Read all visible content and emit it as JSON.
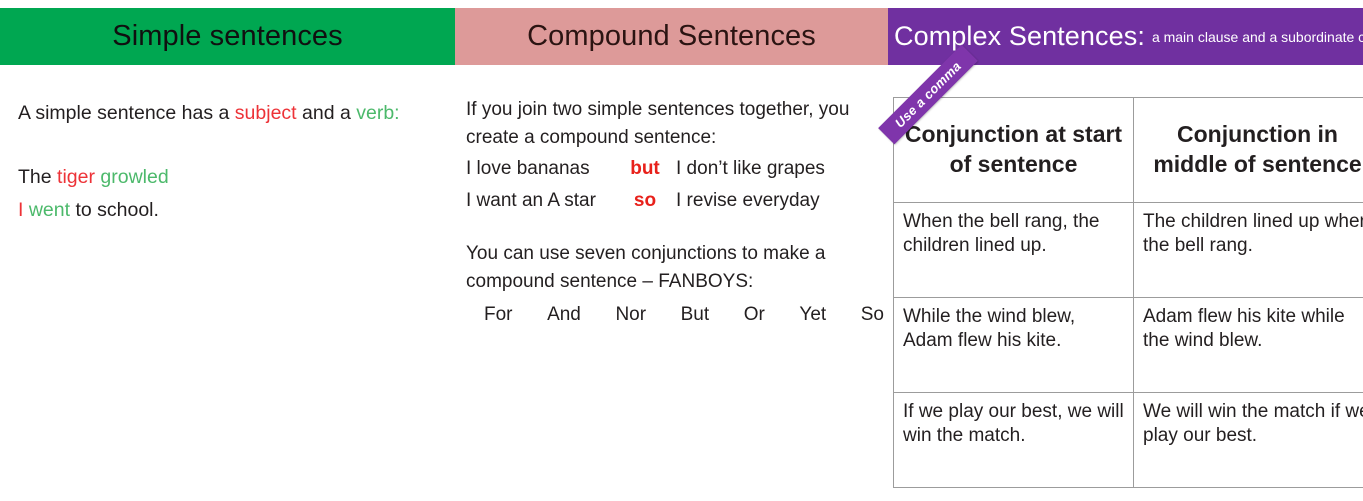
{
  "columns": {
    "simple": {
      "header": "Simple sentences",
      "header_bg": "#00a751",
      "definition": {
        "prefix": "A simple sentence has a ",
        "subject_word": "subject",
        "middle": " and a ",
        "verb_word": "verb",
        "suffix": ":"
      },
      "examples": [
        {
          "part1": "The ",
          "subject": "tiger",
          "space": " ",
          "verb": "growled",
          "part2": ""
        },
        {
          "part1": "",
          "subject": "I",
          "space": " ",
          "verb": "went",
          "part2": " to school."
        }
      ],
      "subject_color": "#ed3237",
      "verb_color": "#4cb96b"
    },
    "compound": {
      "header": "Compound Sentences",
      "header_bg": "#dd9a99",
      "intro": "If you join two simple sentences together, you create a compound sentence:",
      "examples": [
        {
          "left": "I love bananas",
          "conjunction": "but",
          "right": "I don’t like grapes"
        },
        {
          "left": "I want an A star",
          "conjunction": "so",
          "right": "I revise everyday"
        }
      ],
      "conjunction_color": "#e8211b",
      "fanboys_intro": "You can use seven conjunctions to make a compound sentence – FANBOYS:",
      "fanboys": [
        "For",
        "And",
        "Nor",
        "But",
        "Or",
        "Yet",
        "So"
      ]
    },
    "complex": {
      "header": "Complex Sentences:",
      "header_subtitle": "a main clause and a subordinate clause",
      "header_bg": "#7030a0",
      "ribbon_label": "Use a comma",
      "ribbon_bg": "#7f35ab",
      "table": {
        "headers": [
          "Conjunction at start of sentence",
          "Conjunction in middle of sentence"
        ],
        "rows": [
          [
            "When the bell rang, the children lined up.",
            "The children lined up when the bell rang."
          ],
          [
            "While the wind blew, Adam flew his kite.",
            "Adam flew his kite while the wind blew."
          ],
          [
            "If we play our best, we will win the match.",
            "We will win the match if we play our best."
          ]
        ]
      }
    }
  }
}
